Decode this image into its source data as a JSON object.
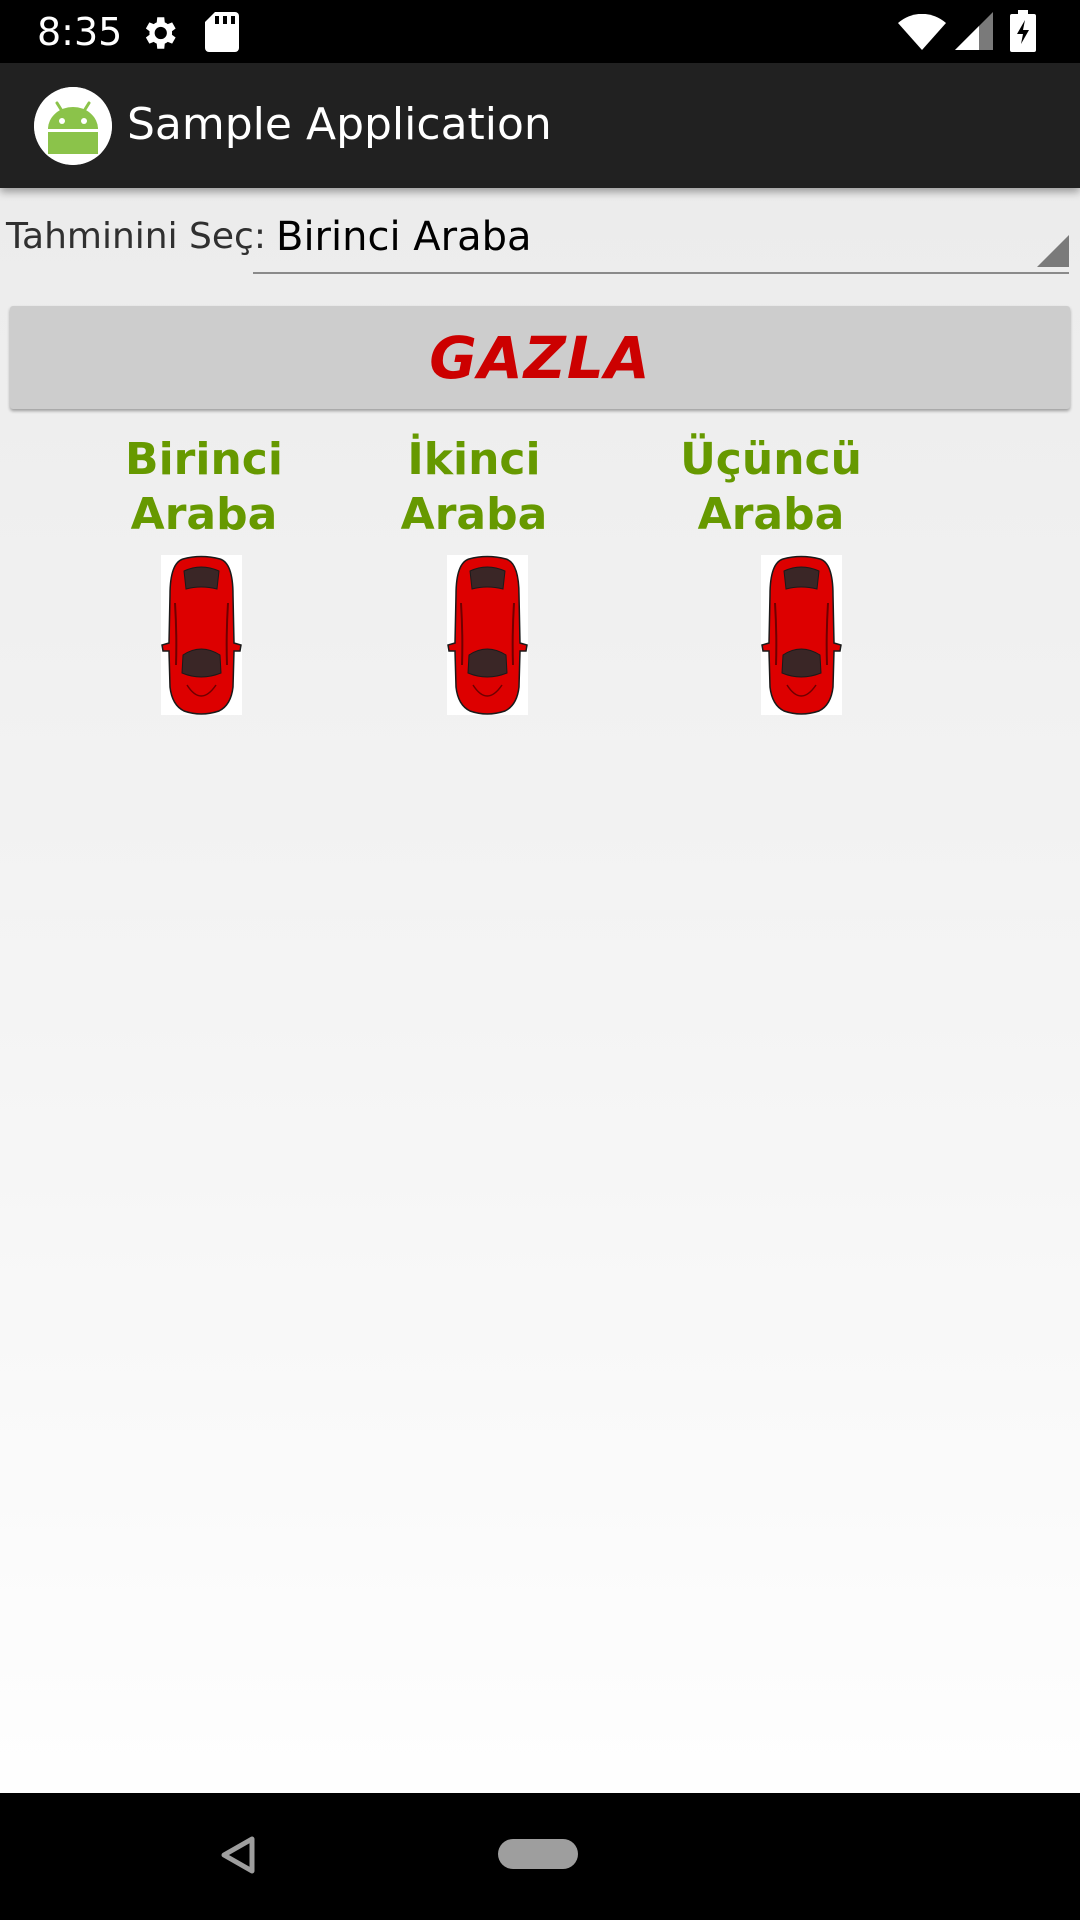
{
  "status_bar": {
    "time": "8:35",
    "icons": [
      "settings-icon",
      "sd-card-icon",
      "wifi-icon",
      "signal-icon",
      "battery-charging-icon"
    ]
  },
  "app_bar": {
    "title": "Sample Application",
    "logo_icon": "android-icon"
  },
  "form": {
    "spinner_label": "Tahminini Seç:",
    "spinner_value": "Birinci Araba"
  },
  "action": {
    "button_label": "GAZLA"
  },
  "cars": [
    {
      "line1": "Birinci",
      "line2": "Araba",
      "icon": "car-icon"
    },
    {
      "line1": "İkinci",
      "line2": "Araba",
      "icon": "car-icon"
    },
    {
      "line1": "Üçüncü",
      "line2": "Araba",
      "icon": "car-icon"
    }
  ],
  "nav_bar": {
    "icons": [
      "back-icon",
      "home-icon"
    ]
  },
  "colors": {
    "accent_red": "#cc0000",
    "label_green": "#669900",
    "car_red": "#dd0000",
    "app_bar": "#212121"
  }
}
